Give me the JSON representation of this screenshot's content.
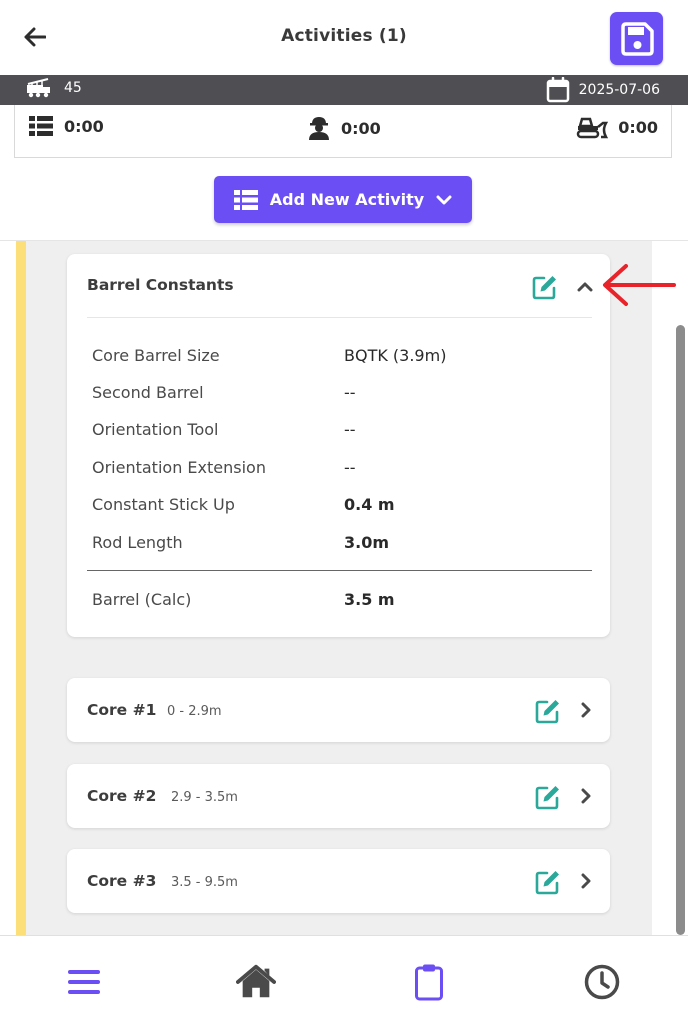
{
  "header": {
    "title": "Activities (1)"
  },
  "info_bar": {
    "rig_number": "45",
    "date": "2025-07-06"
  },
  "stats": {
    "activity_time": "0:00",
    "crew_time": "0:00",
    "equipment_time": "0:00"
  },
  "add_button": {
    "label": "Add New Activity"
  },
  "barrel_constants": {
    "title": "Barrel Constants",
    "rows": [
      {
        "label": "Core Barrel Size",
        "value": "BQTK (3.9m)"
      },
      {
        "label": "Second Barrel",
        "value": "--"
      },
      {
        "label": "Orientation Tool",
        "value": "--"
      },
      {
        "label": "Orientation Extension",
        "value": "--"
      },
      {
        "label": "Constant Stick Up",
        "value": "0.4 m"
      },
      {
        "label": "Rod Length",
        "value": "3.0m"
      }
    ],
    "calc": {
      "label": "Barrel (Calc)",
      "value": "3.5 m"
    }
  },
  "cores": [
    {
      "title": "Core #1",
      "range": "0 - 2.9m"
    },
    {
      "title": "Core #2",
      "range": "2.9 - 3.5m"
    },
    {
      "title": "Core #3",
      "range": "3.5 - 9.5m"
    }
  ],
  "colors": {
    "accent": "#6c4ef5",
    "edit_teal": "#2aa89a",
    "info_bar": "#4f4f53",
    "highlight_yellow": "#fddf7a",
    "annotation_red": "#e8232a"
  },
  "icons": {
    "back": "arrow-left-icon",
    "save": "floppy-disk-icon",
    "rig": "drill-truck-icon",
    "date": "calendar-icon",
    "activity": "list-icon",
    "crew": "worker-icon",
    "equipment": "bulldozer-icon",
    "edit": "edit-icon",
    "nav_menu": "hamburger-menu-icon",
    "nav_home": "home-icon",
    "nav_clipboard": "clipboard-icon",
    "nav_history": "clock-icon"
  }
}
